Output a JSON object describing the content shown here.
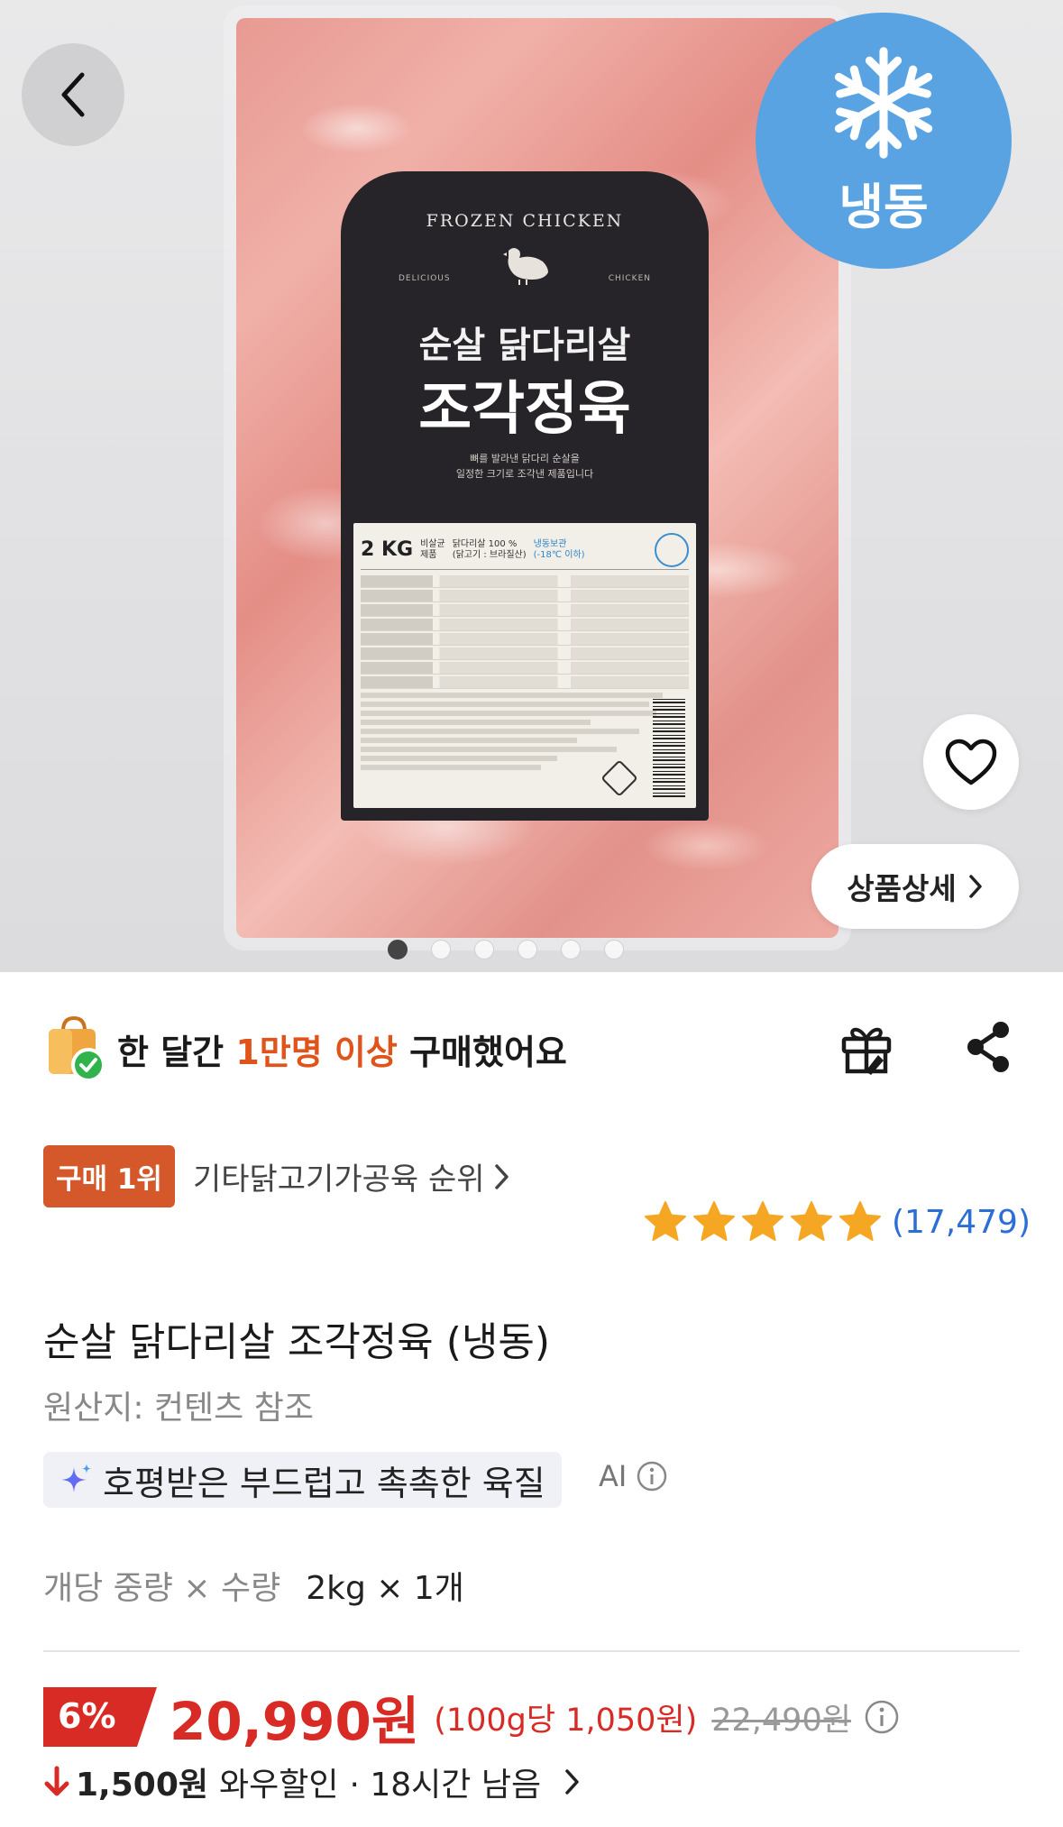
{
  "hero": {
    "label_arch_text": "FROZEN CHICKEN",
    "label_sub_left": "DELICIOUS",
    "label_sub_right": "CHICKEN",
    "label_title_1": "순살 닭다리살",
    "label_title_2": "조각정육",
    "label_desc_1": "뼈를 발라낸 닭다리 순살을",
    "label_desc_2": "일정한 크기로 조각낸 제품입니다",
    "label_weight": "2 KG",
    "label_sterile_1": "비살균",
    "label_sterile_2": "제품",
    "label_content_1": "닭다리살 100 %",
    "label_content_2": "(닭고기 : 브라질산)",
    "label_storage_1": "냉동보관",
    "label_storage_2": "(-18℃ 이하)",
    "frozen_badge": "냉동",
    "detail_button": "상품상세",
    "gallery_total": 6,
    "gallery_active": 1
  },
  "purchase": {
    "prefix": "한 달간 ",
    "highlight": "1만명 이상",
    "suffix": " 구매했어요"
  },
  "rank": {
    "badge": "구매 1위",
    "category": "기타닭고기가공육 순위"
  },
  "rating": {
    "stars": 5,
    "count": "(17,479)"
  },
  "product": {
    "title": "순살 닭다리살 조각정육 (냉동)",
    "origin": "원산지: 컨텐츠 참조",
    "ai_summary": "호평받은 부드럽고 촉촉한 육질",
    "ai_tag": "AI"
  },
  "quantity": {
    "label": "개당 중량 × 수량",
    "value": "2kg × 1개"
  },
  "price": {
    "discount": "6%",
    "sale_price": "20,990원",
    "unit_price": "(100g당 1,050원)",
    "original_price": "22,490원"
  },
  "wow": {
    "amount": "1,500원",
    "label": "와우할인",
    "time": "· 18시간 남음"
  },
  "colors": {
    "accent_orange": "#e0531a",
    "rank_badge": "#d4582a",
    "price_red": "#d92b25",
    "star": "#f5a623",
    "review_blue": "#2b6fd6",
    "frozen_blue": "#5aa3e3"
  },
  "icons": [
    "back-arrow-icon",
    "snowflake-icon",
    "heart-icon",
    "chevron-right-icon",
    "shopping-bag-check-icon",
    "gift-icon",
    "share-icon",
    "star-icon",
    "sparkle-icon",
    "info-icon",
    "arrow-down-icon"
  ]
}
